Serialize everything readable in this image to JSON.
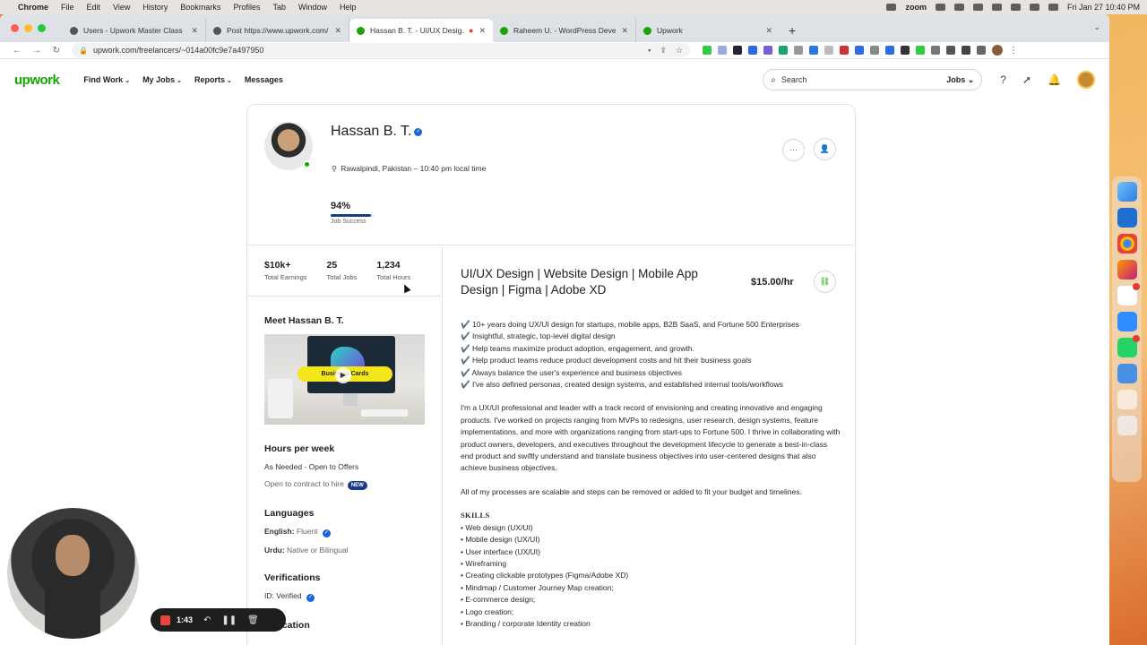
{
  "menubar": {
    "app": "Chrome",
    "items": [
      "File",
      "Edit",
      "View",
      "History",
      "Bookmarks",
      "Profiles",
      "Tab",
      "Window",
      "Help"
    ],
    "zoom_label": "zoom",
    "datetime": "Fri Jan 27  10:40 PM"
  },
  "browser": {
    "tabs": [
      {
        "title": "Users - Upwork Master Class",
        "color": "#555555"
      },
      {
        "title": "Post https://www.upwork.com/...",
        "color": "#555555"
      },
      {
        "title": "Hassan B. T. - UI/UX Desig...",
        "color": "#14a800"
      },
      {
        "title": "Raheem U. - WordPress Devel...",
        "color": "#14a800"
      },
      {
        "title": "Upwork",
        "color": "#14a800"
      }
    ],
    "url": "upwork.com/freelancers/~014a00fc9e7a497950"
  },
  "upwork": {
    "logo": "upwork",
    "nav": [
      "Find Work",
      "My Jobs",
      "Reports",
      "Messages"
    ],
    "search_placeholder": "Search",
    "search_scope": "Jobs",
    "accent": "#14a800"
  },
  "profile": {
    "name": "Hassan B. T.",
    "location": "Rawalpindi, Pakistan – 10:40 pm local time",
    "job_success": "94%",
    "job_success_value": 0.94,
    "job_success_label": "Job Success",
    "stats": [
      {
        "value": "$10k+",
        "label": "Total Earnings"
      },
      {
        "value": "25",
        "label": "Total Jobs"
      },
      {
        "value": "1,234",
        "label": "Total Hours"
      }
    ],
    "meet_heading": "Meet Hassan B. T.",
    "video_banner": "Business Cards",
    "hours_heading": "Hours per week",
    "hours_value": "As Needed - Open to Offers",
    "contract_to_hire": "Open to contract to hire",
    "new_badge": "NEW",
    "languages_heading": "Languages",
    "languages": [
      {
        "name": "English:",
        "level": "Fluent"
      },
      {
        "name": "Urdu:",
        "level": "Native or Bilingual"
      }
    ],
    "verifications_heading": "Verifications",
    "id_label": "ID:",
    "id_value": "Verified",
    "education_heading": "Education",
    "title": "UI/UX Design | Website Design | Mobile App Design | Figma | Adobe XD",
    "rate": "$15.00/hr",
    "bullets": [
      "✔️ 10+ years doing UX/UI design for startups, mobile apps, B2B SaaS, and Fortune 500 Enterprises",
      "✔️ Insightful, strategic, top-level digital design",
      "✔️ Help teams maximize product adoption, engagement, and growth.",
      "✔️ Help product teams reduce product development costs and hit their business goals",
      "✔️ Always balance the user's experience and business objectives",
      "✔️ I've also defined personas, created design systems, and established internal tools/workflows"
    ],
    "para1": "I'm a UX/UI professional and leader with a track record of envisioning and creating innovative and engaging products. I've worked on projects ranging from MVPs to redesigns, user research, design systems, feature implementations, and more with organizations ranging from start-ups to Fortune 500. I thrive in collaborating with product owners, developers, and executives throughout the development lifecycle to generate a best-in-class end product and swiftly understand and translate business objectives into user-centered designs that also achieve business objectives.",
    "para2": "All of my processes are scalable and steps can be removed or added to fit your budget and timelines.",
    "skills_heading": "SKILLS",
    "skills": [
      "• Web design (UX/UI)",
      "• Mobile design (UX/UI)",
      "• User interface (UX/UI)",
      "• Wireframing",
      "• Creating clickable prototypes (Figma/Adobe XD)",
      "• Mindmap / Customer Journey Map creation;",
      "• E-commerce design;",
      "• Logo creation;",
      "• Branding / corporate Identity creation"
    ]
  },
  "recorder": {
    "time": "1:43"
  }
}
